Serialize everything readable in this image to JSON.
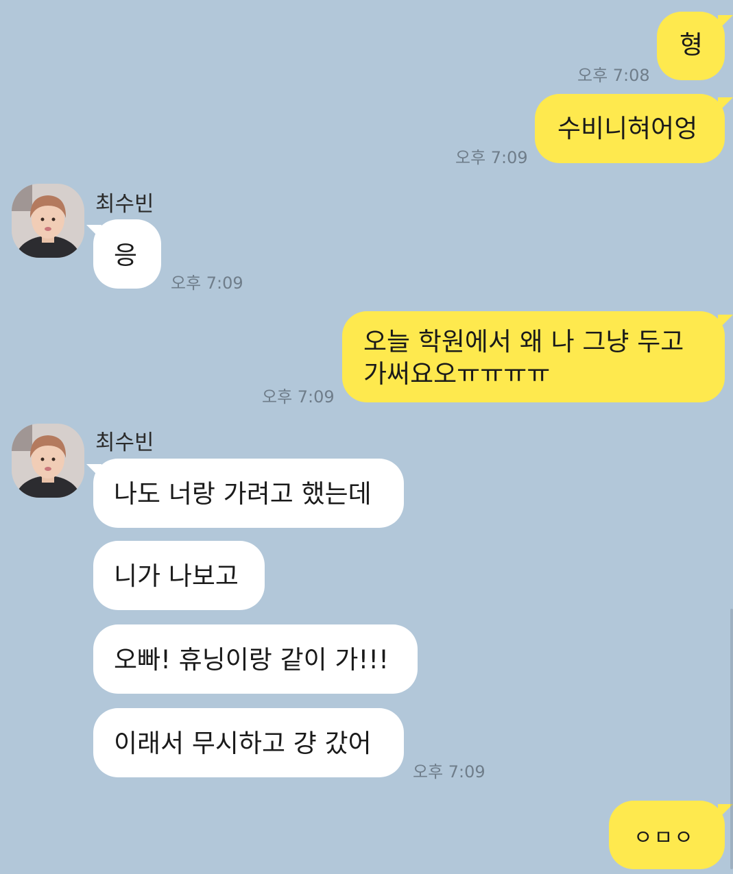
{
  "messages": [
    {
      "sender": "me",
      "text": "형",
      "time": "오후 7:08"
    },
    {
      "sender": "me",
      "text": "수비니혀어엉",
      "time": "오후 7:09"
    },
    {
      "sender": "them",
      "name": "최수빈",
      "text": "응",
      "time": "오후 7:09"
    },
    {
      "sender": "me",
      "lines": [
        "오늘 학원에서 왜 나 그냥 두고",
        "가써요오ㅠㅠㅠㅠ"
      ],
      "time": "오후 7:09"
    },
    {
      "sender": "them",
      "name": "최수빈",
      "text": "나도 너랑 가려고 했는데"
    },
    {
      "sender": "them",
      "text": "니가 나보고"
    },
    {
      "sender": "them",
      "text": "오빠! 휴닝이랑 같이 가!!!"
    },
    {
      "sender": "them",
      "text": "이래서 무시하고 걍 갔어",
      "time": "오후 7:09"
    },
    {
      "sender": "me",
      "text": "ㅇㅁㅇ"
    }
  ],
  "colors": {
    "background": "#b2c7d9",
    "my_bubble": "#fee94e",
    "their_bubble": "#ffffff",
    "timestamp": "#6f7d8a"
  }
}
